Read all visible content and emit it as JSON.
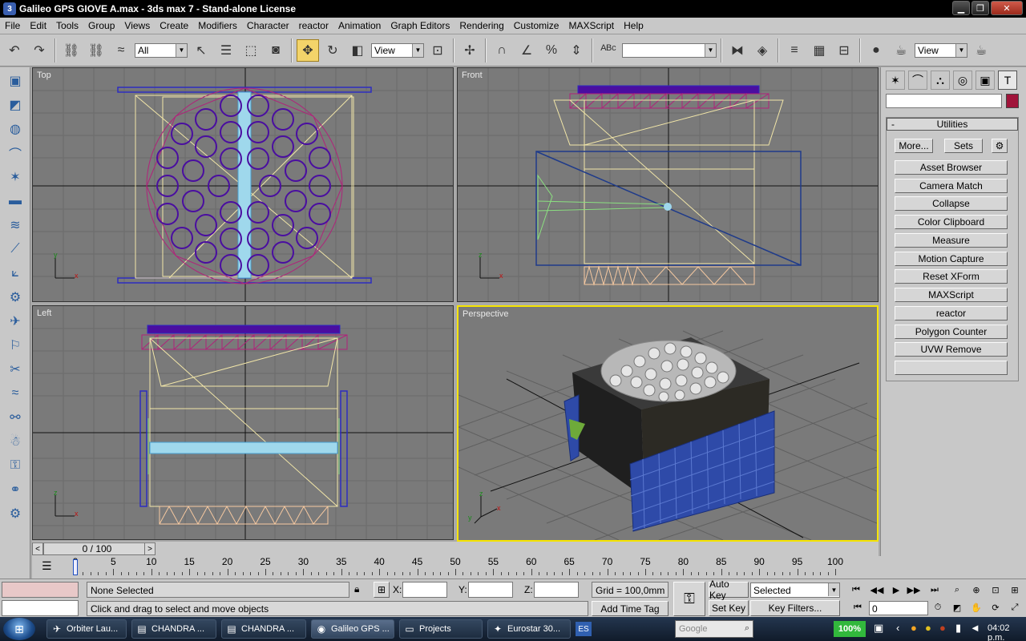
{
  "window": {
    "title": "Galileo GPS GIOVE A.max - 3ds max 7  - Stand-alone License"
  },
  "menu": [
    "File",
    "Edit",
    "Tools",
    "Group",
    "Views",
    "Create",
    "Modifiers",
    "Character",
    "reactor",
    "Animation",
    "Graph Editors",
    "Rendering",
    "Customize",
    "MAXScript",
    "Help"
  ],
  "toolbar": {
    "selection_filter": "All",
    "ref_coord": "View",
    "named_selection": "",
    "render_type": "View"
  },
  "viewports": {
    "top": "Top",
    "front": "Front",
    "left": "Left",
    "perspective": "Perspective"
  },
  "command_panel": {
    "rollout_title": "Utilities",
    "more_label": "More...",
    "sets_label": "Sets",
    "utilities": [
      "Asset Browser",
      "Camera Match",
      "Collapse",
      "Color Clipboard",
      "Measure",
      "Motion Capture",
      "Reset XForm",
      "MAXScript",
      "reactor",
      "Polygon Counter",
      "UVW Remove",
      ""
    ]
  },
  "timeline": {
    "slider_label": "0 / 100",
    "ticks": [
      "0",
      "5",
      "10",
      "15",
      "20",
      "25",
      "30",
      "35",
      "40",
      "45",
      "50",
      "55",
      "60",
      "65",
      "70",
      "75",
      "80",
      "85",
      "90",
      "95",
      "100"
    ]
  },
  "status": {
    "selection": "None Selected",
    "prompt": "Click and drag to select and move objects",
    "x_label": "X:",
    "y_label": "Y:",
    "z_label": "Z:",
    "grid": "Grid = 100,0mm",
    "add_time_tag": "Add Time Tag",
    "auto_key": "Auto Key",
    "set_key": "Set Key",
    "key_mode": "Selected",
    "key_filters": "Key Filters...",
    "frame": "0"
  },
  "taskbar": {
    "tasks": [
      "Orbiter Lau...",
      "CHANDRA ...",
      "CHANDRA ...",
      "Galileo GPS ...",
      "Projects",
      "Eurostar 30..."
    ],
    "language": "ES",
    "search_placeholder": "Google",
    "zoom": "100%",
    "clock": "04:02 p.m."
  },
  "colors": {
    "selection_yellow": "#f5e400",
    "viewport_bg": "#7a7a7a",
    "ui_gray": "#c8c8c8",
    "wire_purple": "#4a0ea0",
    "wire_tan": "#f2e6a8"
  }
}
